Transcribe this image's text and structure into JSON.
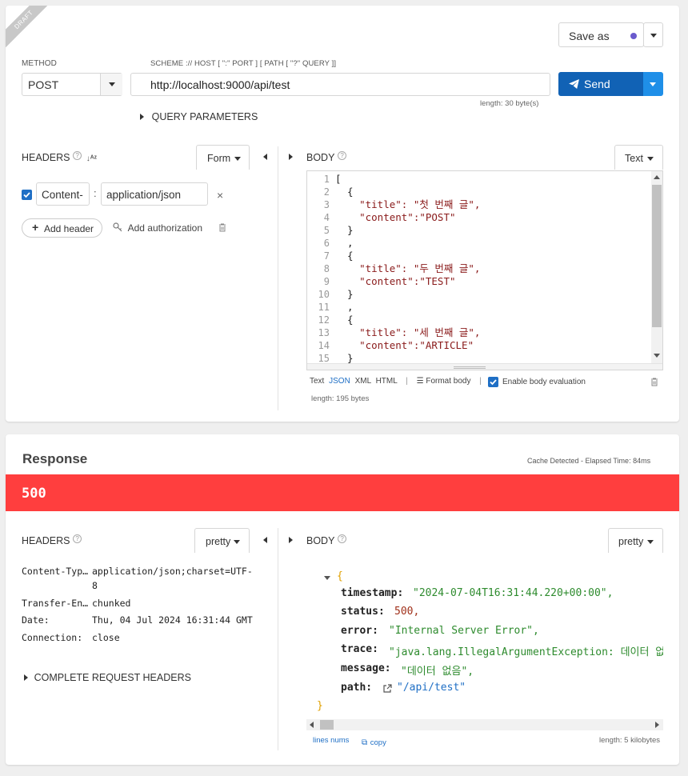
{
  "request": {
    "draft_label": "DRAFT",
    "save_as_label": "Save as",
    "method_label": "METHOD",
    "method_value": "POST",
    "url_label": "SCHEME :// HOST [ \":\" PORT ] [ PATH [ \"?\" QUERY ]]",
    "url_value": "http://localhost:9000/api/test",
    "url_length": "length: 30 byte(s)",
    "send_label": "Send",
    "query_params_label": "QUERY PARAMETERS",
    "headers_label": "HEADERS",
    "form_label": "Form",
    "header_name": "Content-",
    "header_value": "application/json",
    "add_header_label": "Add header",
    "add_auth_label": "Add authorization",
    "body_label": "BODY",
    "text_label": "Text",
    "body_lines": [
      "[",
      "  {",
      "    \"title\": \"첫 번째 글\",",
      "    \"content\":\"POST\"",
      "  }",
      "  ,",
      "  {",
      "    \"title\": \"두 번째 글\",",
      "    \"content\":\"TEST\"",
      "  }",
      "  ,",
      "  {",
      "    \"title\": \"세 번째 글\",",
      "    \"content\":\"ARTICLE\"",
      "  }"
    ],
    "line_numbers": [
      "1",
      "2",
      "3",
      "4",
      "5",
      "6",
      "7",
      "8",
      "9",
      "10",
      "11",
      "12",
      "13",
      "14",
      "15"
    ],
    "fmt_text": "Text",
    "fmt_json": "JSON",
    "fmt_xml": "XML",
    "fmt_html": "HTML",
    "format_body_label": "Format body",
    "enable_eval_label": "Enable body evaluation",
    "body_length": "length: 195 bytes"
  },
  "response": {
    "title": "Response",
    "cache_info": "Cache Detected - Elapsed Time: 84ms",
    "status_code": "500",
    "status_color": "#ff3e3e",
    "headers_label": "HEADERS",
    "pretty_label": "pretty",
    "headers": [
      {
        "k": "Content-Typ…",
        "v": "application/json;charset=UTF-"
      },
      {
        "k": "",
        "v": "8"
      },
      {
        "k": "Transfer-En…",
        "v": "chunked"
      },
      {
        "k": "Date:",
        "v": "Thu, 04 Jul 2024 16:31:44 GMT"
      },
      {
        "k": "Connection:",
        "v": "close"
      }
    ],
    "complete_headers_label": "COMPLETE REQUEST HEADERS",
    "body_label": "BODY",
    "open_brace": "{",
    "close_brace": "}",
    "fields": {
      "timestamp_k": "timestamp:",
      "timestamp_v": "\"2024-07-04T16:31:44.220+00:00\",",
      "status_k": "status:",
      "status_v": "500,",
      "error_k": "error:",
      "error_v": "\"Internal Server Error\",",
      "trace_k": "trace:",
      "trace_v": "\"java.lang.IllegalArgumentException: 데이터 없",
      "message_k": "message:",
      "message_v": "\"데이터 없음\",",
      "path_k": "path:",
      "path_v": "\"/api/test\""
    },
    "line_nums_label": "lines nums",
    "copy_label": "copy",
    "body_length": "length: 5 kilobytes"
  },
  "colors": {
    "accent_blue": "#1f6fc5",
    "send_blue": "#1162b5",
    "error_red": "#ff3e3e",
    "draft_dot": "#6a5acd"
  }
}
